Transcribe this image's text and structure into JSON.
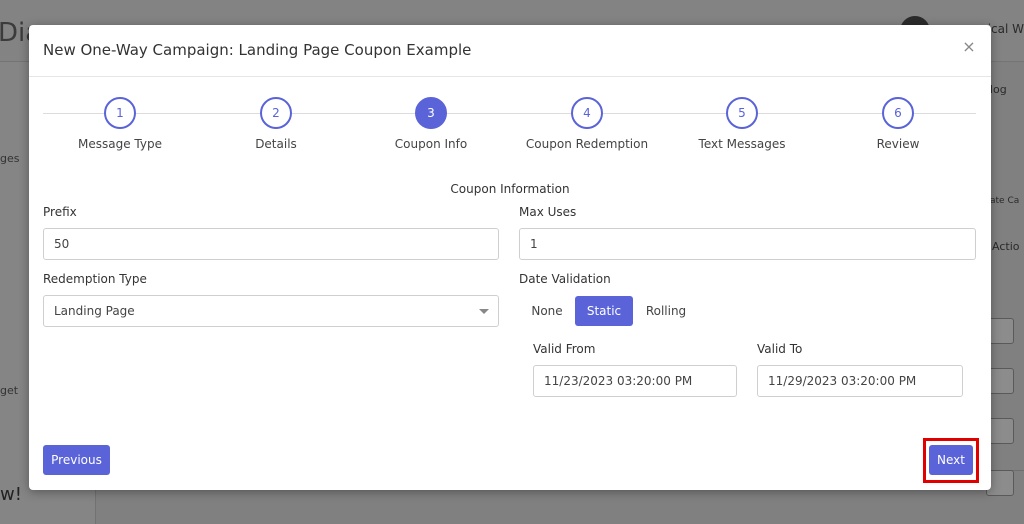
{
  "background": {
    "brand": "Dia",
    "user_name": "ical W",
    "sidebar_texts": [
      "ges",
      "get"
    ],
    "bottom_text": "w!",
    "right_texts": [
      "log",
      "ate Ca",
      "Actio"
    ]
  },
  "modal": {
    "title": "New One-Way Campaign: Landing Page Coupon Example",
    "close_symbol": "×"
  },
  "stepper": {
    "active_index": 2,
    "steps": [
      {
        "number": "1",
        "label": "Message Type"
      },
      {
        "number": "2",
        "label": "Details"
      },
      {
        "number": "3",
        "label": "Coupon Info"
      },
      {
        "number": "4",
        "label": "Coupon Redemption"
      },
      {
        "number": "5",
        "label": "Text Messages"
      },
      {
        "number": "6",
        "label": "Review"
      }
    ]
  },
  "form": {
    "section_title": "Coupon Information",
    "prefix_label": "Prefix",
    "prefix_value": "50",
    "max_uses_label": "Max Uses",
    "max_uses_value": "1",
    "redemption_type_label": "Redemption Type",
    "redemption_type_value": "Landing Page",
    "date_validation_label": "Date Validation",
    "date_validation_options": [
      "None",
      "Static",
      "Rolling"
    ],
    "date_validation_selected": "Static",
    "valid_from_label": "Valid From",
    "valid_from_value": "11/23/2023 03:20:00 PM",
    "valid_to_label": "Valid To",
    "valid_to_value": "11/29/2023 03:20:00 PM"
  },
  "footer": {
    "previous_label": "Previous",
    "next_label": "Next"
  },
  "colors": {
    "accent": "#5a63d8",
    "highlight": "#e00000"
  }
}
